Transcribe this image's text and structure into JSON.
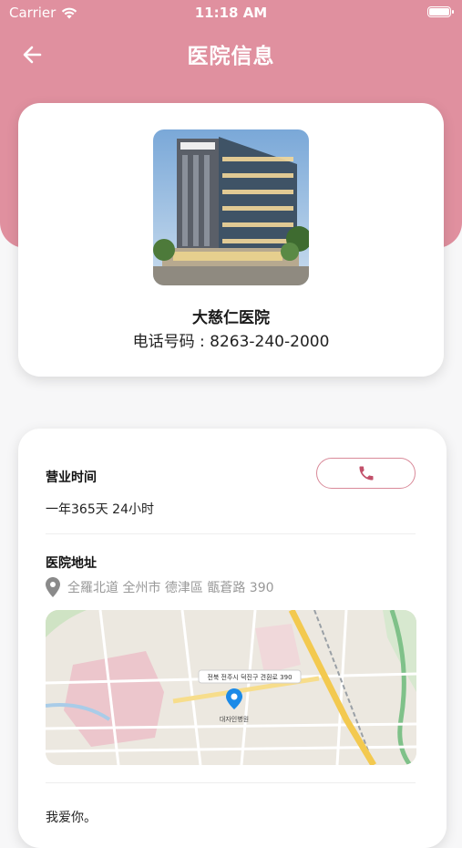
{
  "status_bar": {
    "carrier": "Carrier",
    "time": "11:18 AM"
  },
  "nav": {
    "title": "医院信息"
  },
  "hospital": {
    "name": "大慈仁医院",
    "phone_line": "电话号码 : 8263-240-2000"
  },
  "hours": {
    "label": "营业时间",
    "value": "一年365天 24小时"
  },
  "address": {
    "label": "医院地址",
    "value": "全羅北道 全州市 德津區 甑蒼路 390"
  },
  "map": {
    "marker_label": "전북 전주시 덕진구 견훤로 390",
    "place_label": "대자인병원"
  },
  "note": "我爱你。",
  "colors": {
    "header": "#e0909f",
    "accent": "#c2506a",
    "background": "#f7f7f8"
  }
}
